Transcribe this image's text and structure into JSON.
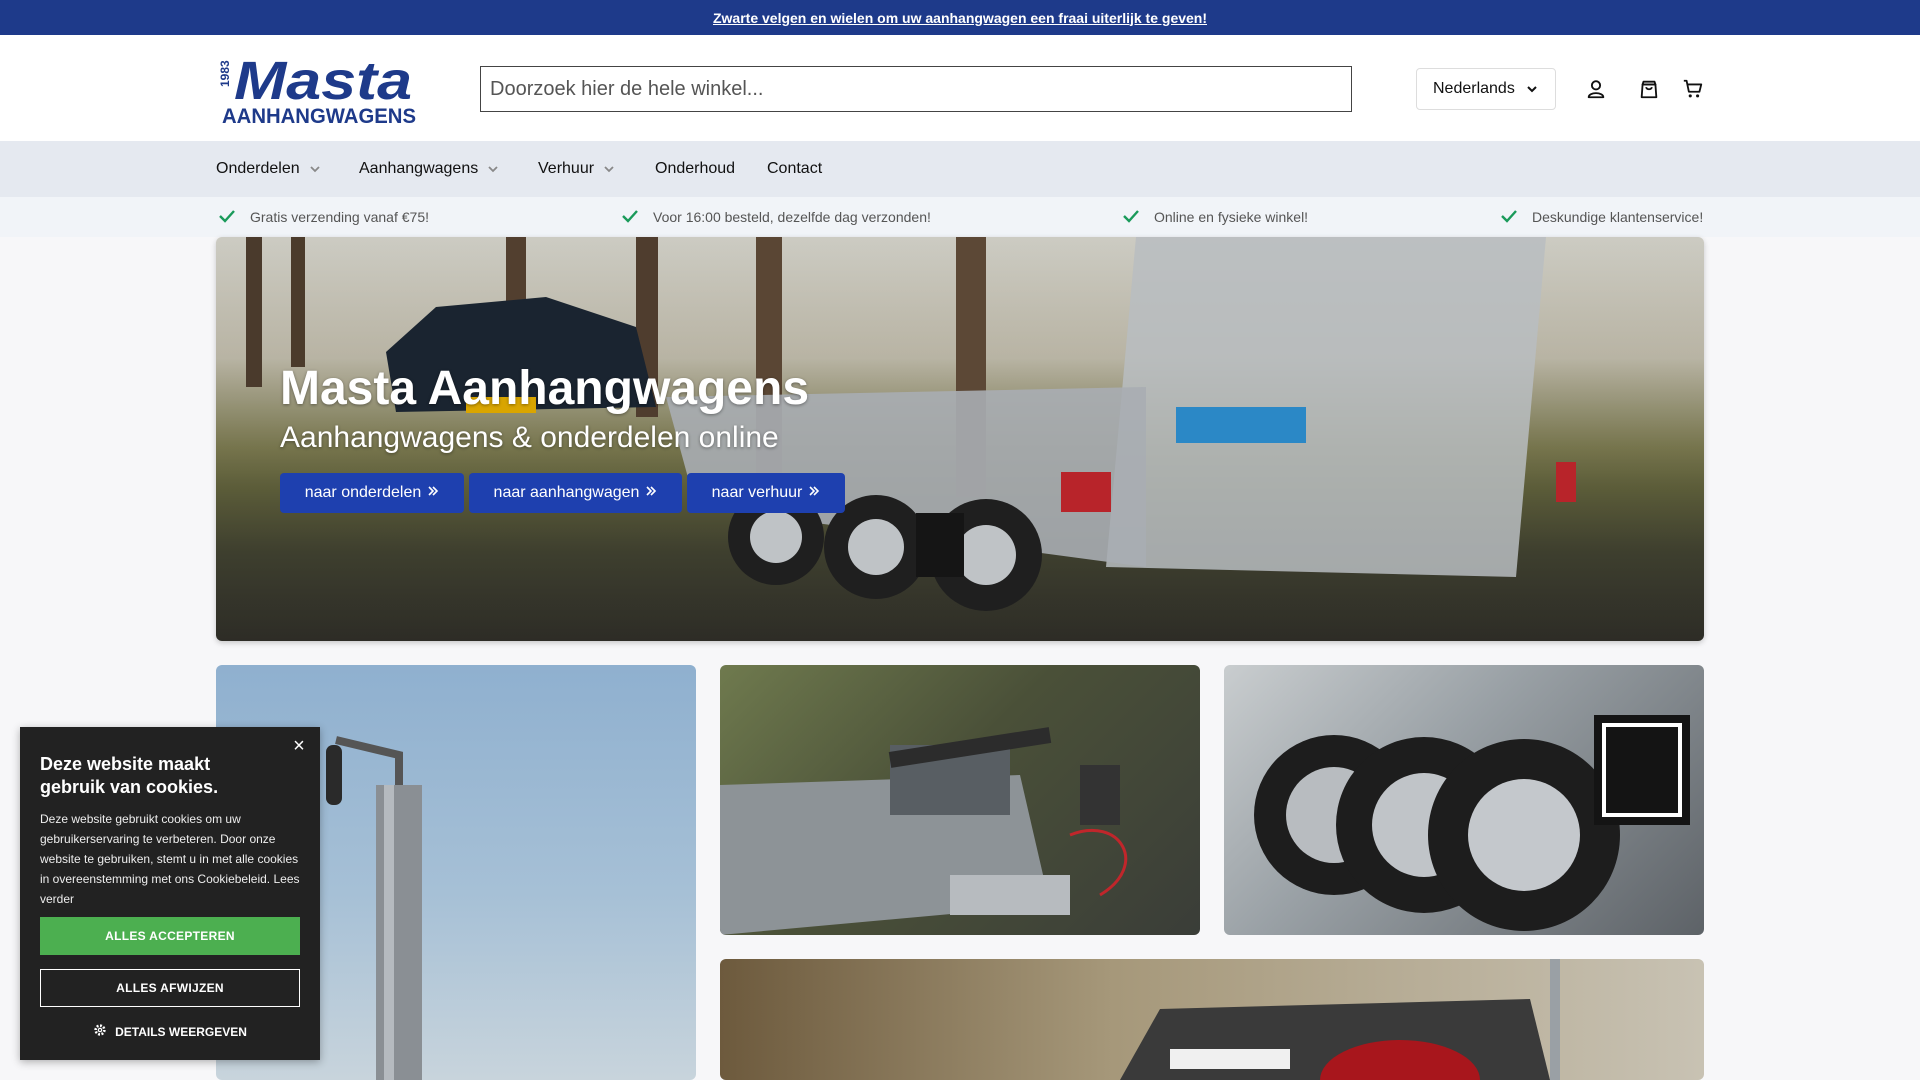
{
  "announcement": {
    "text": "Zwarte velgen en wielen om uw aanhangwagen een fraai uiterlijk te geven!"
  },
  "header": {
    "logo": {
      "year": "1983",
      "brand": "Masta",
      "tagline": "AANHANGWAGENS"
    },
    "search": {
      "placeholder": "Doorzoek hier de hele winkel..."
    },
    "language": {
      "selected": "Nederlands"
    },
    "icons": [
      "user-icon",
      "shopping-bag-icon",
      "cart-icon"
    ]
  },
  "nav": {
    "items": [
      {
        "label": "Onderdelen",
        "dropdown": true
      },
      {
        "label": "Aanhangwagens",
        "dropdown": true
      },
      {
        "label": "Verhuur",
        "dropdown": true
      },
      {
        "label": "Onderhoud",
        "dropdown": false
      },
      {
        "label": "Contact",
        "dropdown": false
      }
    ]
  },
  "usps": [
    "Gratis verzending vanaf €75!",
    "Voor 16:00 besteld, dezelfde dag verzonden!",
    "Online en fysieke winkel!",
    "Deskundige klantenservice!"
  ],
  "hero": {
    "title": "Masta Aanhangwagens",
    "subtitle": "Aanhangwagens & onderdelen online",
    "buttons": [
      "naar onderdelen",
      "naar aanhangwagen",
      "naar verhuur"
    ]
  },
  "cookie": {
    "title": "Deze website maakt gebruik van cookies.",
    "text": "Deze website gebruikt cookies om uw gebruikerservaring te verbeteren. Door onze website te gebruiken, stemt u in met alle cookies in overeenstemming met ons Cookiebeleid.",
    "read_more": "Lees verder",
    "accept": "ALLES ACCEPTEREN",
    "reject": "ALLES AFWIJZEN",
    "details": "DETAILS WEERGEVEN"
  },
  "colors": {
    "brand": "#1e3a8a",
    "button": "#1e40af",
    "accept": "#4caf50",
    "check": "#1a9a5a"
  }
}
